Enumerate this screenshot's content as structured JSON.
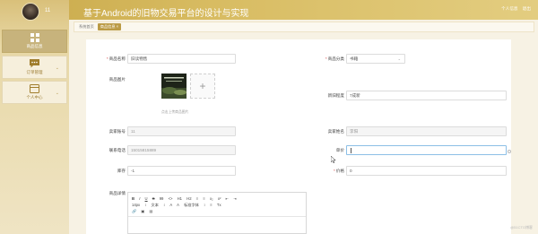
{
  "header": {
    "title": "基于Android的旧物交易平台的设计与实现",
    "user_name": "11",
    "personal_info": "个人信息",
    "exit": "退出"
  },
  "sidebar": {
    "items": [
      {
        "label": "商品信息",
        "icon": "grid-icon"
      },
      {
        "label": "订单管理",
        "icon": "message-icon"
      },
      {
        "label": "个人中心",
        "icon": "wallet-icon"
      }
    ]
  },
  "breadcrumb": {
    "home": "系统首页",
    "current": "商品信息 ×"
  },
  "form": {
    "product_name_label": "商品名称",
    "product_name_value": "旧读物售",
    "category_label": "商品分类",
    "category_value": "书籍",
    "image_label": "商品图片",
    "image_tip": "点击上传商品图片",
    "new_old_label": "新旧程度",
    "new_old_value": "7成新",
    "merchant_account_label": "卖家账号",
    "merchant_account_value": "11",
    "merchant_name_label": "卖家姓名",
    "merchant_name_value": "李阳",
    "phone_label": "联系电话",
    "phone_value": "15015815889",
    "price_label": "单价",
    "price_value": "",
    "stock_label": "库存",
    "stock_value": "-1",
    "sales_label": "价格",
    "sales_value": "0",
    "detail_label": "商品详情",
    "upload_plus": "+"
  },
  "editor": {
    "toolbar_row1": [
      "B",
      "I",
      "U",
      "S",
      "99",
      "<>",
      "H1",
      "H2",
      "≡",
      "≡",
      "x₂",
      "x²",
      "⇤",
      "⇥"
    ],
    "toolbar_row2": [
      "14px",
      "↕",
      "文本",
      "↕",
      "A",
      "A",
      "标准字体",
      "↕",
      "≡",
      "Tx"
    ],
    "toolbar_row3": [
      "🔗",
      "▣",
      "▤"
    ]
  },
  "watermark": "@51CTO博客"
}
